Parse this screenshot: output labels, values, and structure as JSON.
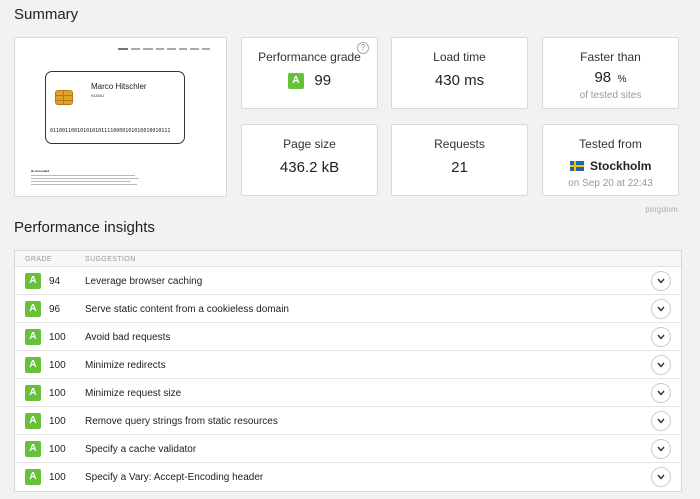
{
  "summary": {
    "title": "Summary",
    "screenshot": {
      "card_name": "Marco Hitschler",
      "card_number": "918301",
      "card_binary": "0110011001010101011110000101010010010111",
      "blurb_heading": "Hi Ascended"
    },
    "performance_grade": {
      "label": "Performance grade",
      "grade": "A",
      "value": "99",
      "help": "?"
    },
    "load_time": {
      "label": "Load time",
      "value": "430 ms"
    },
    "faster_than": {
      "label": "Faster than",
      "value": "98",
      "unit": "%",
      "sub": "of tested sites"
    },
    "page_size": {
      "label": "Page size",
      "value": "436.2 kB"
    },
    "requests": {
      "label": "Requests",
      "value": "21"
    },
    "tested_from": {
      "label": "Tested from",
      "location": "Stockholm",
      "date": "on Sep 20 at 22:43"
    },
    "brand": "pingdom"
  },
  "insights": {
    "title": "Performance insights",
    "columns": {
      "grade": "GRADE",
      "suggestion": "SUGGESTION"
    },
    "rows": [
      {
        "grade": "A",
        "score": "94",
        "suggestion": "Leverage browser caching"
      },
      {
        "grade": "A",
        "score": "96",
        "suggestion": "Serve static content from a cookieless domain"
      },
      {
        "grade": "A",
        "score": "100",
        "suggestion": "Avoid bad requests"
      },
      {
        "grade": "A",
        "score": "100",
        "suggestion": "Minimize redirects"
      },
      {
        "grade": "A",
        "score": "100",
        "suggestion": "Minimize request size"
      },
      {
        "grade": "A",
        "score": "100",
        "suggestion": "Remove query strings from static resources"
      },
      {
        "grade": "A",
        "score": "100",
        "suggestion": "Specify a cache validator"
      },
      {
        "grade": "A",
        "score": "100",
        "suggestion": "Specify a Vary: Accept-Encoding header"
      }
    ]
  },
  "colors": {
    "grade_green": "#67c23a",
    "flag_blue": "#1e67b0",
    "flag_yellow": "#f5c400"
  },
  "icons": {
    "help": "question-circle-icon",
    "chevron": "chevron-down-icon",
    "flag": "sweden-flag-icon",
    "chip": "card-chip-icon"
  }
}
